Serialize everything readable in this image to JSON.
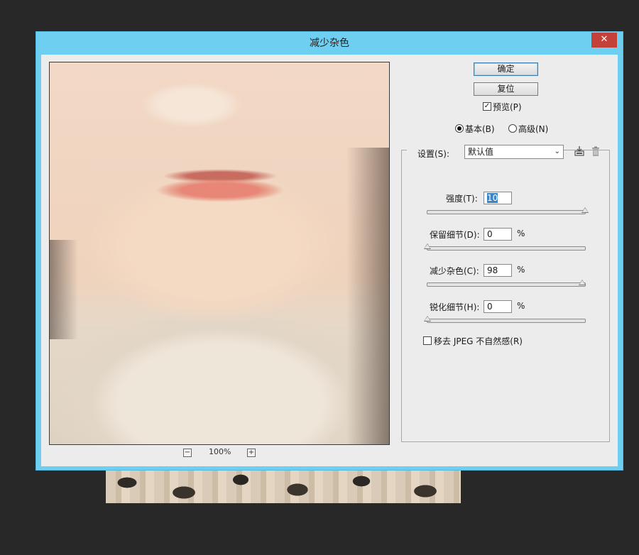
{
  "dialog": {
    "title": "减少杂色",
    "close_symbol": "✕"
  },
  "buttons": {
    "ok": "确定",
    "reset": "复位"
  },
  "preview_toggle": {
    "label": "预览(P)",
    "checked": true
  },
  "mode": {
    "basic": {
      "label": "基本(B)",
      "selected": true
    },
    "advanced": {
      "label": "高级(N)",
      "selected": false
    }
  },
  "settings": {
    "label": "设置(S):",
    "selected": "默认值",
    "save_icon": "save-preset-icon",
    "delete_icon": "trash-icon"
  },
  "controls": {
    "strength": {
      "label": "强度(T):",
      "value": "10",
      "unit": "",
      "level": 1.0
    },
    "preserve": {
      "label": "保留细节(D):",
      "value": "0",
      "unit": "%",
      "level": 0.0
    },
    "reduce": {
      "label": "减少杂色(C):",
      "value": "98",
      "unit": "%",
      "level": 0.98
    },
    "sharpen": {
      "label": "锐化细节(H):",
      "value": "0",
      "unit": "%",
      "level": 0.0
    }
  },
  "jpeg": {
    "label": "移去 JPEG 不自然感(R)",
    "checked": false
  },
  "zoom": {
    "level": "100%",
    "minus": "−",
    "plus": "+"
  },
  "colors": {
    "titlebar": "#6fcff0",
    "close": "#c4413a",
    "panel": "#ececec",
    "selection": "#3b84c9"
  }
}
